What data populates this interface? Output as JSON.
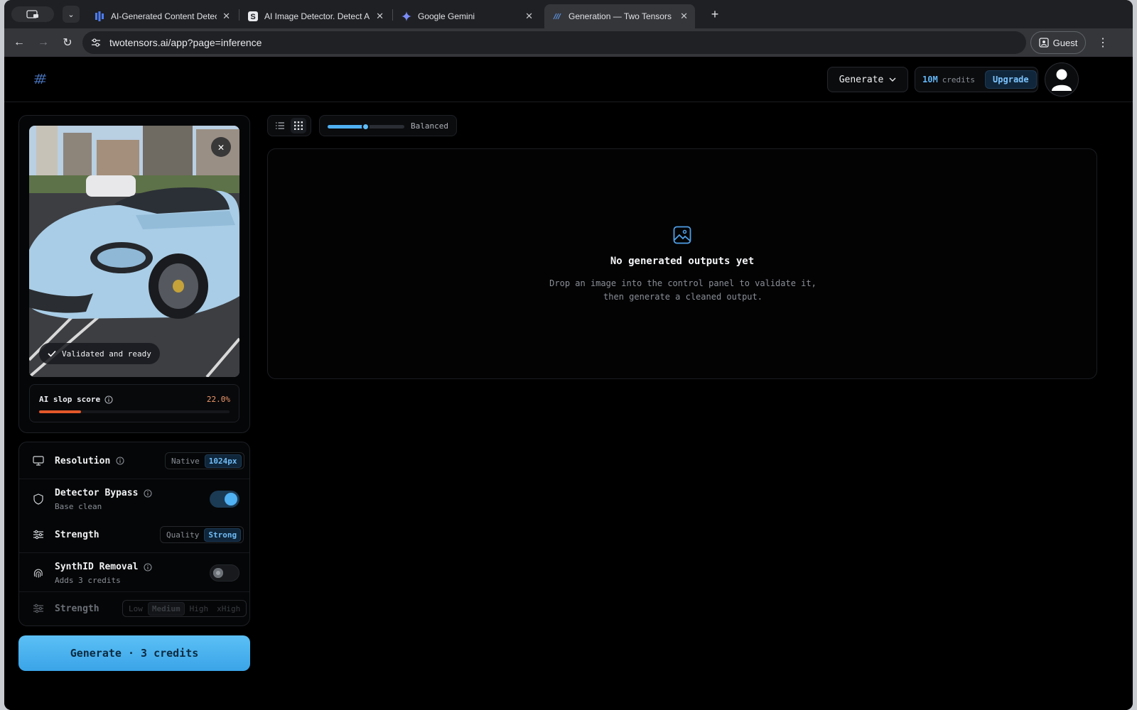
{
  "browser": {
    "tabs": [
      {
        "title": "AI-Generated Content Detect",
        "favicon": "bars-icon",
        "active": false
      },
      {
        "title": "AI Image Detector. Detect AI-",
        "favicon": "s-icon",
        "active": false
      },
      {
        "title": "Google Gemini",
        "favicon": "gemini-icon",
        "active": false
      },
      {
        "title": "Generation — Two Tensors",
        "favicon": "twotensors-icon",
        "active": true
      }
    ],
    "url": "twotensors.ai/app?page=inference",
    "profile_label": "Guest"
  },
  "header": {
    "mode_select": "Generate",
    "credits_value": "10M",
    "credits_label": "credits",
    "upgrade_label": "Upgrade"
  },
  "upload": {
    "status_label": "Validated and ready",
    "score_label": "AI slop score",
    "score_value": "22.0%",
    "score_fraction": 0.22
  },
  "options": {
    "resolution": {
      "label": "Resolution",
      "choices": [
        "Native",
        "1024px"
      ],
      "selected": "1024px"
    },
    "detector_bypass": {
      "label": "Detector Bypass",
      "sublabel": "Base clean",
      "enabled": true
    },
    "strength": {
      "label": "Strength",
      "choices": [
        "Quality",
        "Strong"
      ],
      "selected": "Strong"
    },
    "synthid_removal": {
      "label": "SynthID Removal",
      "sublabel": "Adds 3 credits",
      "enabled": false
    },
    "synthid_strength": {
      "label": "Strength",
      "choices": [
        "Low",
        "Medium",
        "High",
        "xHigh"
      ],
      "selected": "Medium",
      "disabled": true
    }
  },
  "generate_button": "Generate · 3 credits",
  "view": {
    "mode": "grid",
    "quality_label": "Balanced",
    "quality_fraction": 0.5
  },
  "outputs": {
    "empty_title": "No generated outputs yet",
    "empty_desc": "Drop an image into the control panel to validate it, then generate a cleaned output."
  },
  "colors": {
    "accent": "#4fb0f2",
    "score_bar": "#e4582a",
    "score_text": "#f2996a",
    "background": "#000000"
  }
}
